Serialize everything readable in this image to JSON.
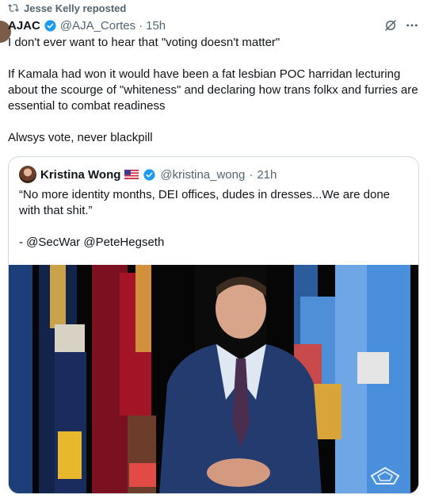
{
  "repost": {
    "text": "Jesse Kelly reposted",
    "icon": "repost-icon"
  },
  "post": {
    "author_name": "AJAC",
    "verified": true,
    "handle": "@AJA_Cortes",
    "dot": "·",
    "time": "15h",
    "paragraphs": [
      "I don't ever want to hear that \"voting doesn't matter\"",
      "If Kamala had won it would have been a fat lesbian POC harridan lecturing about the scourge of \"whiteness\" and declaring how trans folkx and furries are essential to combat readiness",
      "Alwsys vote, never blackpill"
    ]
  },
  "quote": {
    "author_name": "Kristina Wong",
    "flag": "us-flag-emoji",
    "verified": true,
    "handle": "@kristina_wong",
    "dot": "·",
    "time": "21h",
    "paragraphs": [
      "“No more identity months, DEI offices, dudes in dresses...We are done with that shit.”",
      "- @SecWar @PeteHegseth"
    ]
  },
  "colors": {
    "accent": "#1d9bf0",
    "text": "#0f1419",
    "muted": "#536471",
    "border": "#cfd9de"
  },
  "icons": {
    "verified": "verified-badge-icon",
    "grok": "grok-icon",
    "more": "more-icon"
  }
}
